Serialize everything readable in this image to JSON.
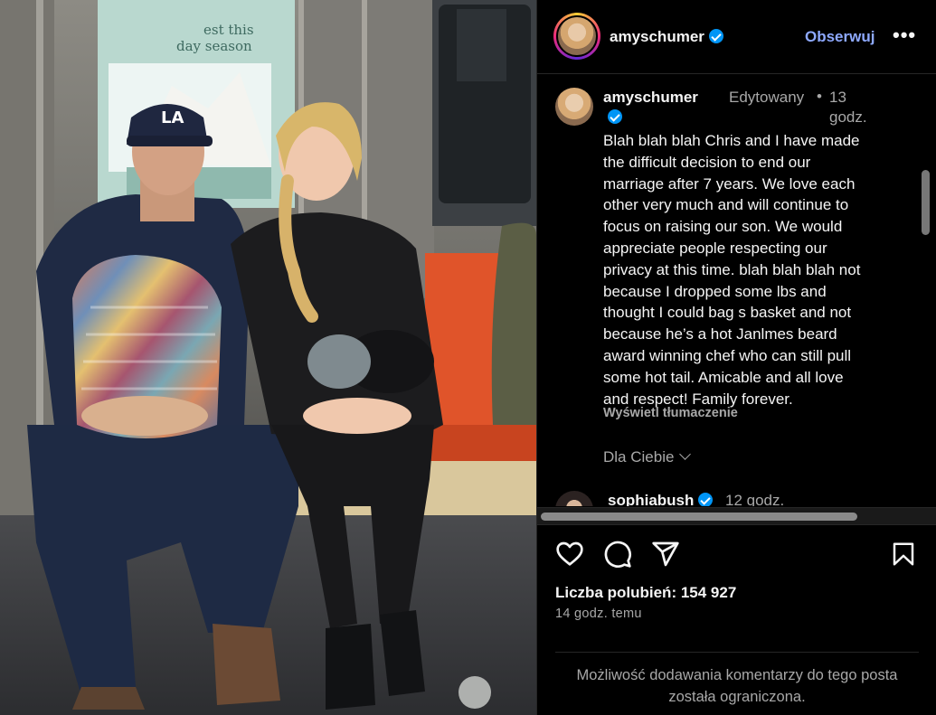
{
  "photo": {
    "subject": "subway-photo",
    "poster_text": [
      "est this",
      "day season"
    ]
  },
  "header": {
    "username": "amyschumer",
    "follow_label": "Obserwuj",
    "more_label": "•••"
  },
  "caption": {
    "username": "amyschumer",
    "edited_label": "Edytowany",
    "separator": "•",
    "time": "13 godz.",
    "lines": [
      "Blah blah blah Chris and I have made",
      "the difficult decision to end our",
      "marriage after 7 years. We love each",
      "other very much and will continue to",
      "focus on raising our son. We would",
      "appreciate people respecting our",
      "privacy at this time. blah blah blah not",
      "because I dropped some lbs and",
      "thought I could bag s basket and not",
      "because he’s a hot Janlmes beard",
      "award winning chef who can still pull",
      "some hot tail. Amicable and all love",
      "and respect! Family forever."
    ],
    "translate_label": "Wyświetl tłumaczenie",
    "for_you_label": "Dla Ciebie"
  },
  "next_comment": {
    "username": "sophiabush",
    "time": "12 godz."
  },
  "actions": {
    "icons": [
      "heart-icon",
      "comment-icon",
      "share-icon",
      "bookmark-icon"
    ]
  },
  "likes_label": "Liczba polubień: 154 927",
  "posted_ago": "14 godz. temu",
  "comments_limited": "Możliwość dodawania komentarzy do tego posta została ograniczona.",
  "colors": {
    "follow": "#8ea9ff",
    "verified": "#0095f6",
    "secondary_text": "#a8a8a8",
    "background": "#000000"
  }
}
